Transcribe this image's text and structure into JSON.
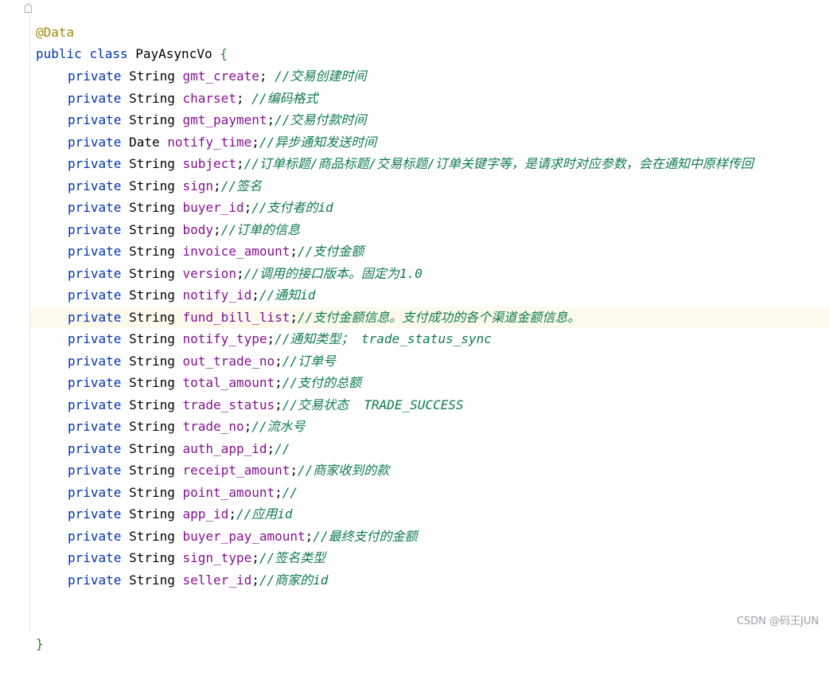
{
  "header": {
    "annotation": "@Data",
    "kw_public": "public",
    "kw_class": "class",
    "class_name": "PayAsyncVo",
    "open_brace": "{",
    "close_brace": "}"
  },
  "fields": [
    {
      "mod": "private",
      "type": "String",
      "name": "gmt_create",
      "sep": "; ",
      "comment": "//交易创建时间"
    },
    {
      "mod": "private",
      "type": "String",
      "name": "charset",
      "sep": "; ",
      "comment": "//编码格式"
    },
    {
      "mod": "private",
      "type": "String",
      "name": "gmt_payment",
      "sep": ";",
      "comment": "//交易付款时间"
    },
    {
      "mod": "private",
      "type": "Date",
      "name": "notify_time",
      "sep": ";",
      "comment": "//异步通知发送时间"
    },
    {
      "mod": "private",
      "type": "String",
      "name": "subject",
      "sep": ";",
      "comment": "//订单标题/商品标题/交易标题/订单关键字等，是请求时对应参数，会在通知中原样传回"
    },
    {
      "mod": "private",
      "type": "String",
      "name": "sign",
      "sep": ";",
      "comment": "//签名"
    },
    {
      "mod": "private",
      "type": "String",
      "name": "buyer_id",
      "sep": ";",
      "comment": "//支付者的id"
    },
    {
      "mod": "private",
      "type": "String",
      "name": "body",
      "sep": ";",
      "comment": "//订单的信息"
    },
    {
      "mod": "private",
      "type": "String",
      "name": "invoice_amount",
      "sep": ";",
      "comment": "//支付金额"
    },
    {
      "mod": "private",
      "type": "String",
      "name": "version",
      "sep": ";",
      "comment": "//调用的接口版本。固定为1.0"
    },
    {
      "mod": "private",
      "type": "String",
      "name": "notify_id",
      "sep": ";",
      "comment": "//通知id"
    },
    {
      "mod": "private",
      "type": "String",
      "name": "fund_bill_list",
      "sep": ";",
      "comment": "//支付金额信息。支付成功的各个渠道金额信息。"
    },
    {
      "mod": "private",
      "type": "String",
      "name": "notify_type",
      "sep": ";",
      "comment": "//通知类型； trade_status_sync"
    },
    {
      "mod": "private",
      "type": "String",
      "name": "out_trade_no",
      "sep": ";",
      "comment": "//订单号"
    },
    {
      "mod": "private",
      "type": "String",
      "name": "total_amount",
      "sep": ";",
      "comment": "//支付的总额"
    },
    {
      "mod": "private",
      "type": "String",
      "name": "trade_status",
      "sep": ";",
      "comment": "//交易状态  TRADE_SUCCESS"
    },
    {
      "mod": "private",
      "type": "String",
      "name": "trade_no",
      "sep": ";",
      "comment": "//流水号"
    },
    {
      "mod": "private",
      "type": "String",
      "name": "auth_app_id",
      "sep": ";",
      "comment": "//"
    },
    {
      "mod": "private",
      "type": "String",
      "name": "receipt_amount",
      "sep": ";",
      "comment": "//商家收到的款"
    },
    {
      "mod": "private",
      "type": "String",
      "name": "point_amount",
      "sep": ";",
      "comment": "//"
    },
    {
      "mod": "private",
      "type": "String",
      "name": "app_id",
      "sep": ";",
      "comment": "//应用id"
    },
    {
      "mod": "private",
      "type": "String",
      "name": "buyer_pay_amount",
      "sep": ";",
      "comment": "//最终支付的金额"
    },
    {
      "mod": "private",
      "type": "String",
      "name": "sign_type",
      "sep": ";",
      "comment": "//签名类型"
    },
    {
      "mod": "private",
      "type": "String",
      "name": "seller_id",
      "sep": ";",
      "comment": "//商家的id"
    }
  ],
  "highlighted_field_index": 11,
  "watermark": "CSDN @码王JUN"
}
